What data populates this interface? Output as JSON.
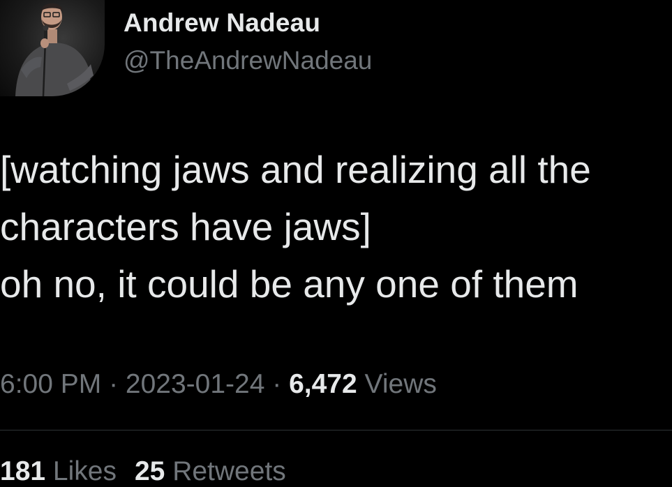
{
  "author": {
    "display_name": "Andrew Nadeau",
    "handle": "@TheAndrewNadeau",
    "avatar_icon": "profile-photo-comedian-with-microphone"
  },
  "tweet": {
    "lines": [
      "[watching jaws and realizing all the",
      "characters have jaws]",
      "oh no, it could be any one of them"
    ]
  },
  "meta": {
    "time": "6:00 PM",
    "separator": " · ",
    "date": "2023-01-24",
    "views_count": "6,472",
    "views_label": "Views"
  },
  "stats": {
    "likes_count": "181",
    "likes_label": "Likes",
    "retweets_count": "25",
    "retweets_label": "Retweets"
  },
  "colors": {
    "background": "#000000",
    "primary_text": "#e7e9ea",
    "secondary_text": "#71767b",
    "divider": "#2f3336"
  }
}
